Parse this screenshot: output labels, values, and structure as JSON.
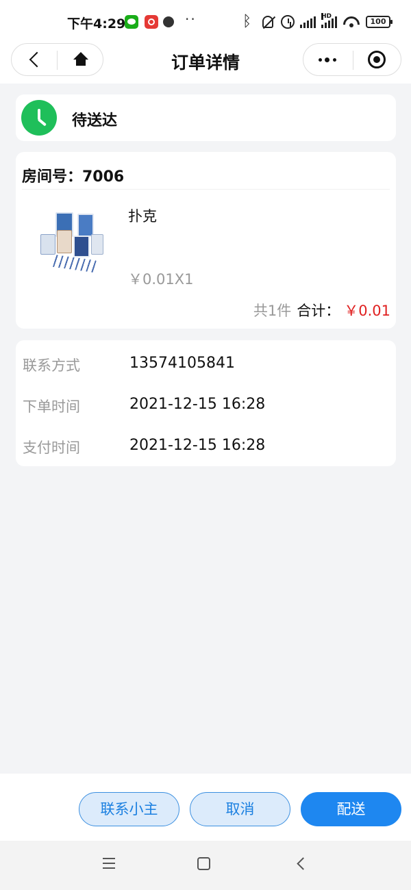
{
  "status_bar": {
    "time": "下午4:29",
    "battery": "100",
    "hd_label": "HD"
  },
  "nav": {
    "title": "订单详情"
  },
  "order_status": {
    "text": "待送达",
    "color": "#1fbf5a"
  },
  "order": {
    "room_label": "房间号：7006",
    "product": {
      "name": "扑克",
      "price_qty": "￥0.01X1",
      "image": "playing-cards-image"
    },
    "count_text": "共1件",
    "total_label": "合计：",
    "total_value": "￥0.01",
    "total_color": "#e02020"
  },
  "info": {
    "rows": [
      {
        "label": "联系方式",
        "value": "13574105841"
      },
      {
        "label": "下单时间",
        "value": "2021-12-15 16:28"
      },
      {
        "label": "支付时间",
        "value": "2021-12-15 16:28"
      }
    ]
  },
  "actions": {
    "contact_label": "联系小主",
    "cancel_label": "取消",
    "deliver_label": "配送",
    "accent": "#1e87f0"
  }
}
